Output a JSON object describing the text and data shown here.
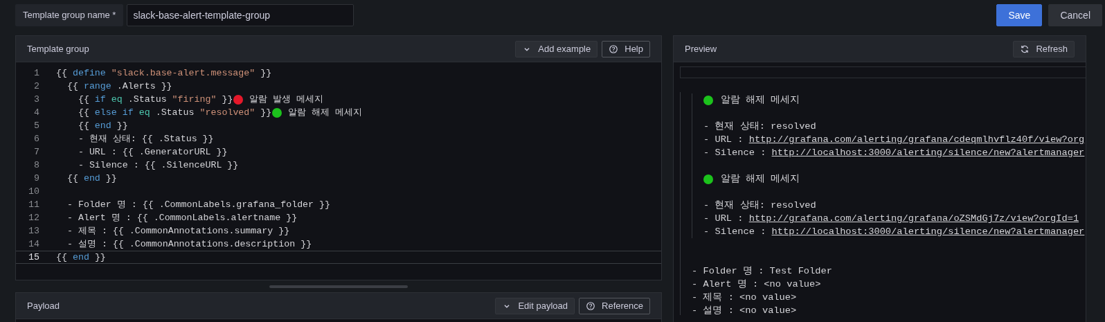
{
  "form": {
    "label": "Template group name *",
    "value": "slack-base-alert-template-group"
  },
  "actions": [
    {
      "label": "Save",
      "kind": "primary"
    },
    {
      "label": "Cancel",
      "kind": "secondary"
    }
  ],
  "template_panel": {
    "title": "Template group",
    "buttons": [
      {
        "label": "Add example",
        "kind": "menu"
      },
      {
        "label": "Help",
        "kind": "outline"
      }
    ],
    "lines": [
      {
        "number": "1",
        "active": false,
        "tokens": [
          {
            "kind": "plain",
            "text": "{{ "
          },
          {
            "kind": "keyword",
            "text": "define "
          },
          {
            "kind": "string",
            "text": "\"slack.base-alert.message\""
          },
          {
            "kind": "plain",
            "text": " }}"
          }
        ]
      },
      {
        "number": "2",
        "active": false,
        "tokens": [
          {
            "kind": "plain",
            "text": "  {{ "
          },
          {
            "kind": "keyword",
            "text": "range"
          },
          {
            "kind": "plain",
            "text": " .Alerts }}"
          }
        ]
      },
      {
        "number": "3",
        "active": false,
        "tokens": [
          {
            "kind": "plain",
            "text": "    {{ "
          },
          {
            "kind": "keyword",
            "text": "if "
          },
          {
            "kind": "function",
            "text": "eq"
          },
          {
            "kind": "plain",
            "text": " .Status "
          },
          {
            "kind": "string",
            "text": "\"firing\""
          },
          {
            "kind": "plain",
            "text": " }}"
          },
          {
            "kind": "dot",
            "color": "#e5182a"
          },
          {
            "kind": "plain",
            "text": " 알람 발생 메세지"
          }
        ]
      },
      {
        "number": "4",
        "active": false,
        "tokens": [
          {
            "kind": "plain",
            "text": "    {{ "
          },
          {
            "kind": "keyword",
            "text": "else if "
          },
          {
            "kind": "function",
            "text": "eq"
          },
          {
            "kind": "plain",
            "text": " .Status "
          },
          {
            "kind": "string",
            "text": "\"resolved\""
          },
          {
            "kind": "plain",
            "text": " }}"
          },
          {
            "kind": "dot",
            "color": "#1cc21c"
          },
          {
            "kind": "plain",
            "text": " 알람 해제 메세지"
          }
        ]
      },
      {
        "number": "5",
        "active": false,
        "tokens": [
          {
            "kind": "plain",
            "text": "    {{ "
          },
          {
            "kind": "keyword",
            "text": "end"
          },
          {
            "kind": "plain",
            "text": " }}"
          }
        ]
      },
      {
        "number": "6",
        "active": false,
        "tokens": [
          {
            "kind": "plain",
            "text": "    - 현재 상태: {{ .Status }}"
          }
        ]
      },
      {
        "number": "7",
        "active": false,
        "tokens": [
          {
            "kind": "plain",
            "text": "    - URL : {{ .GeneratorURL }}"
          }
        ]
      },
      {
        "number": "8",
        "active": false,
        "tokens": [
          {
            "kind": "plain",
            "text": "    - Silence : {{ .SilenceURL }}"
          }
        ]
      },
      {
        "number": "9",
        "active": false,
        "tokens": [
          {
            "kind": "plain",
            "text": "  {{ "
          },
          {
            "kind": "keyword",
            "text": "end"
          },
          {
            "kind": "plain",
            "text": " }}"
          }
        ]
      },
      {
        "number": "10",
        "active": false
      },
      {
        "number": "11",
        "active": false,
        "tokens": [
          {
            "kind": "plain",
            "text": "  - Folder 명 : {{ .CommonLabels.grafana_folder }}"
          }
        ]
      },
      {
        "number": "12",
        "active": false,
        "tokens": [
          {
            "kind": "plain",
            "text": "  - Alert 명 : {{ .CommonLabels.alertname }}"
          }
        ]
      },
      {
        "number": "13",
        "active": false,
        "tokens": [
          {
            "kind": "plain",
            "text": "  - 제목 : {{ .CommonAnnotations.summary }}"
          }
        ]
      },
      {
        "number": "14",
        "active": false,
        "tokens": [
          {
            "kind": "plain",
            "text": "  - 설명 : {{ .CommonAnnotations.description }}"
          }
        ]
      },
      {
        "number": "15",
        "active": true,
        "tokens": [
          {
            "kind": "plain",
            "text": "{{ "
          },
          {
            "kind": "keyword",
            "text": "end"
          },
          {
            "kind": "plain",
            "text": " }}"
          }
        ]
      }
    ]
  },
  "payload_panel": {
    "title": "Payload",
    "buttons": [
      {
        "label": "Edit payload",
        "kind": "menu"
      },
      {
        "label": "Reference",
        "kind": "outline"
      }
    ]
  },
  "preview": {
    "title": "Preview",
    "button": {
      "label": "Refresh",
      "kind": "reload"
    },
    "blocks": [
      {
        "color": "#1cc21c",
        "heading": "알람 해제 메세지",
        "lines": [
          {
            "text": "- 현재 상태: resolved"
          },
          {
            "text": "- URL :",
            "link": "http://grafana.com/alerting/grafana/cdeqmlhvflz40f/view?org"
          },
          {
            "text": "- Silence :",
            "link": "http://localhost:3000/alerting/silence/new?alertmanager"
          }
        ]
      },
      {
        "color": "#1cc21c",
        "heading": "알람 해제 메세지",
        "lines": [
          {
            "text": "- 현재 상태: resolved"
          },
          {
            "text": "- URL :",
            "link": "http://grafana.com/alerting/grafana/oZSMdGj7z/view?orgId=1"
          },
          {
            "text": "- Silence :",
            "link": "http://localhost:3000/alerting/silence/new?alertmanager"
          }
        ]
      }
    ],
    "summary": [
      "- Folder 명 : Test Folder",
      "- Alert 명 : <no value>",
      "- 제목 : <no value>",
      "- 설명 : <no value>"
    ]
  }
}
